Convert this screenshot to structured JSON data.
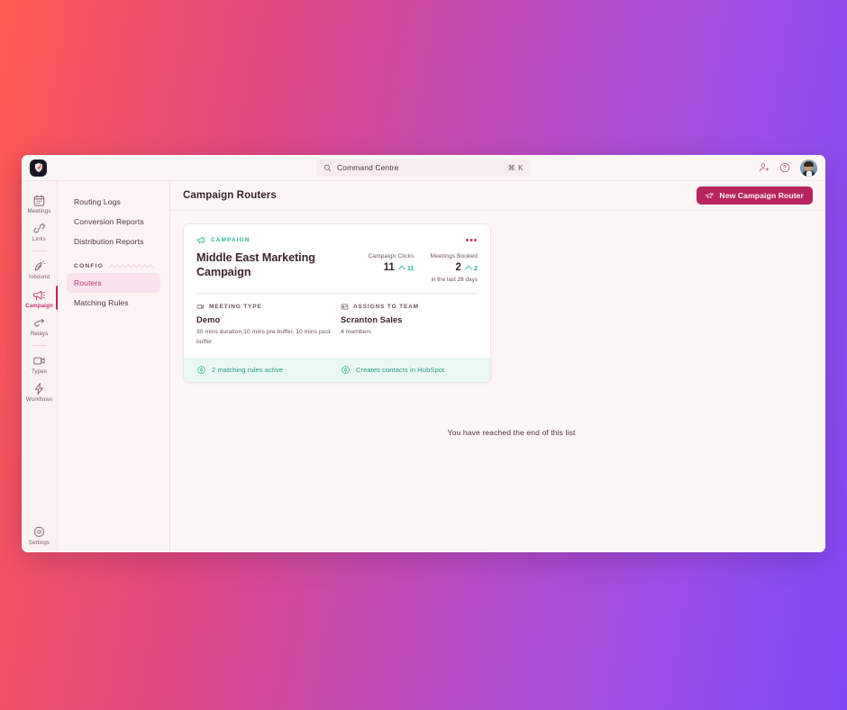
{
  "window": {
    "logo_icon": "shield-rocket-logo"
  },
  "topbar": {
    "search_icon": "search-icon",
    "search_text": "Command Centre",
    "search_shortcut": "⌘ K",
    "add_user_icon": "add-user-icon",
    "help_icon": "help-circle-icon",
    "avatar_alt": "user-avatar"
  },
  "rail": {
    "items": [
      {
        "label": "Meetings",
        "icon": "calendar-icon",
        "active": false
      },
      {
        "label": "Links",
        "icon": "link-icon",
        "active": false
      },
      {
        "label": "Inbound",
        "icon": "inbound-icon",
        "active": false
      },
      {
        "label": "Campaign",
        "icon": "megaphone-icon",
        "active": true
      },
      {
        "label": "Relays",
        "icon": "relay-icon",
        "active": false
      },
      {
        "label": "Types",
        "icon": "video-camera-icon",
        "active": false
      },
      {
        "label": "Workflows",
        "icon": "workflow-icon",
        "active": false
      }
    ],
    "settings": {
      "label": "Settings",
      "icon": "gear-icon"
    }
  },
  "subnav": {
    "items": [
      {
        "label": "Routing Logs",
        "active": false
      },
      {
        "label": "Conversion Reports",
        "active": false
      },
      {
        "label": "Distribution Reports",
        "active": false
      }
    ],
    "group_label": "CONFIG",
    "group_items": [
      {
        "label": "Routers",
        "active": true
      },
      {
        "label": "Matching Rules",
        "active": false
      }
    ]
  },
  "main": {
    "page_title": "Campaign Routers",
    "new_button": {
      "label": "New Campaign Router",
      "icon": "megaphone-plus-icon"
    },
    "end_of_list": "You have reached the end of this list"
  },
  "card": {
    "tag": "CAMPAIGN",
    "tag_icon": "megaphone-icon",
    "menu_icon": "ellipsis-icon",
    "name": "Middle East Marketing Campaign",
    "stats": [
      {
        "label": "Campaign Clicks",
        "value": "11",
        "delta": "11",
        "trend": "up"
      },
      {
        "label": "Meetings Booked",
        "value": "2",
        "delta": "2",
        "trend": "up"
      }
    ],
    "stats_note": "in the last 28 days",
    "columns": [
      {
        "heading": "MEETING TYPE",
        "icon": "video-camera-icon",
        "value": "Demo",
        "sub": "30 mins duration,10 mins pre buffer, 10 mins post buffer"
      },
      {
        "heading": "ASSIGNS TO TEAM",
        "icon": "team-icon",
        "value": "Scranton Sales",
        "sub": "4 members"
      }
    ],
    "footer": [
      {
        "label": "2 matching rules active",
        "icon": "target-icon"
      },
      {
        "label": "Creates contacts in HubSpot",
        "icon": "target-icon"
      }
    ]
  },
  "colors": {
    "accent": "#B8245F",
    "accent_light": "#C4366F",
    "teal": "#2BB596",
    "teal_bg": "#E9F8F3",
    "window_bg": "#FDF6F6",
    "gradient_from": "#FF5A52",
    "gradient_to": "#8049F5"
  }
}
